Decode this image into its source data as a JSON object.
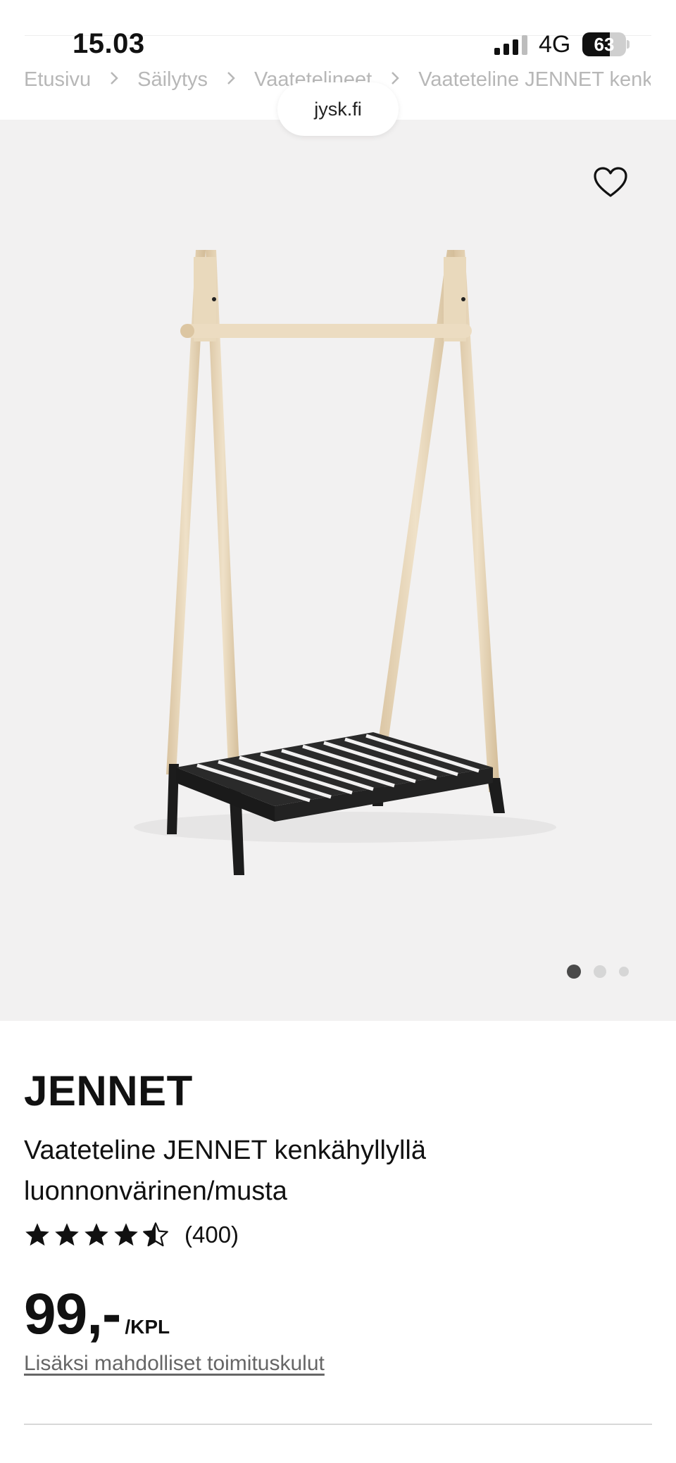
{
  "status_bar": {
    "time": "15.03",
    "network": "4G",
    "battery_level": "63"
  },
  "breadcrumb": [
    "Etusivu",
    "Säilytys",
    "Vaatetelineet",
    "Vaateteline JENNET kenkähyllyllä"
  ],
  "browser": {
    "url": "jysk.fi"
  },
  "gallery": {
    "image_count": 3,
    "active_index": 0,
    "favorite_icon": "heart-outline-icon"
  },
  "product": {
    "name": "JENNET",
    "description": "Vaateteline JENNET kenkähyllyllä luonnonvärinen/musta",
    "rating_stars": 4.5,
    "review_count": "(400)",
    "price": "99,-",
    "price_unit": "/KPL",
    "shipping_note": "Lisäksi mahdolliset toimituskulut"
  },
  "colors": {
    "gallery_bg": "#f2f1f1",
    "text": "#111111",
    "muted": "#666666",
    "breadcrumb": "#b7b7b7",
    "wood": "#e8d6b8",
    "frame_black": "#1c1c1c"
  }
}
